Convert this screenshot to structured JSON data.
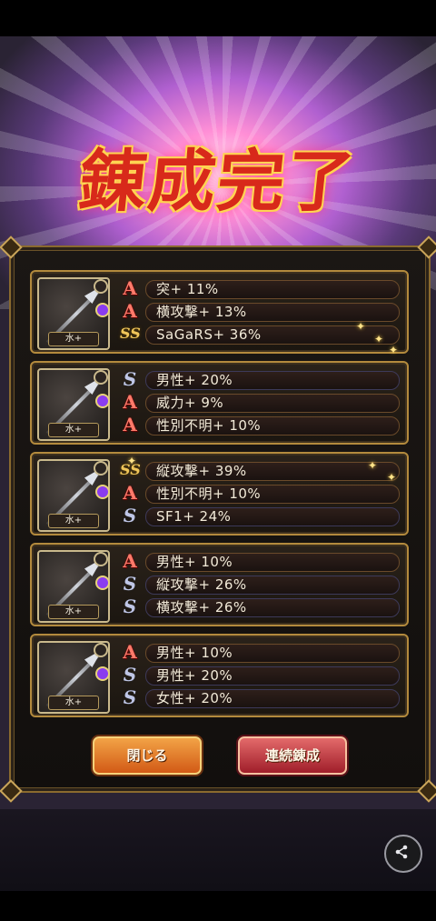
{
  "title": "錬成完了",
  "results": [
    {
      "badge": "水+",
      "stats": [
        {
          "rank": "A",
          "text": "突+ 11%"
        },
        {
          "rank": "A",
          "text": "横攻撃+ 13%"
        },
        {
          "rank": "SS",
          "text": "SaGaRS+ 36%"
        }
      ]
    },
    {
      "badge": "水+",
      "stats": [
        {
          "rank": "S",
          "text": "男性+ 20%"
        },
        {
          "rank": "A",
          "text": "威力+ 9%"
        },
        {
          "rank": "A",
          "text": "性別不明+ 10%"
        }
      ]
    },
    {
      "badge": "水+",
      "stats": [
        {
          "rank": "SS",
          "text": "縦攻撃+ 39%"
        },
        {
          "rank": "A",
          "text": "性別不明+ 10%"
        },
        {
          "rank": "S",
          "text": "SF1+ 24%"
        }
      ]
    },
    {
      "badge": "水+",
      "stats": [
        {
          "rank": "A",
          "text": "男性+ 10%"
        },
        {
          "rank": "S",
          "text": "縦攻撃+ 26%"
        },
        {
          "rank": "S",
          "text": "横攻撃+ 26%"
        }
      ]
    },
    {
      "badge": "水+",
      "stats": [
        {
          "rank": "A",
          "text": "男性+ 10%"
        },
        {
          "rank": "S",
          "text": "男性+ 20%"
        },
        {
          "rank": "S",
          "text": "女性+ 20%"
        }
      ]
    }
  ],
  "rank_glyphs": {
    "A": "A",
    "S": "S",
    "SS": "SS"
  },
  "buttons": {
    "close": "閉じる",
    "repeat": "連続錬成"
  },
  "colors": {
    "rank_A": "#ff7a6a",
    "rank_S": "#bfc6e6",
    "rank_SS": "#f0c65a",
    "close_button": "#e07a2a",
    "repeat_button": "#c0343e"
  },
  "icons": {
    "share": "share-icon"
  }
}
